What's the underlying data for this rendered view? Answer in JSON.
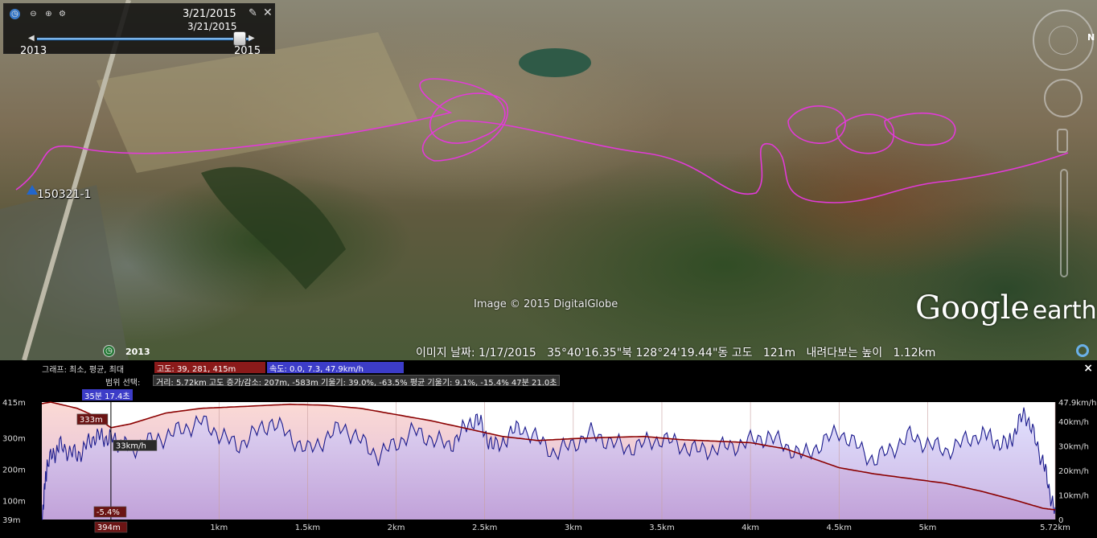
{
  "timebar": {
    "date_current": "3/21/2015",
    "date_slider": "3/21/2015",
    "start_year": "2013",
    "end_year": "2015"
  },
  "map": {
    "placemark_label": "150321-1",
    "imagery_credit": "Image © 2015 DigitalGlobe",
    "logo_google": "Google",
    "logo_earth": "earth",
    "track_color": "#e23ad8"
  },
  "navigation": {
    "north_letter": "N"
  },
  "statusbar": {
    "year_badge": "2013",
    "text": "이미지 날짜: 1/17/2015   35°40'16.35\"북 128°24'19.44\"동 고도   121m   내려다보는 높이   1.12km"
  },
  "profile": {
    "graph_label": "그래프: 최소, 평균, 최대",
    "altitude_stats": "고도: 39, 281, 415m",
    "speed_stats": "속도: 0.0, 7.3, 47.9km/h",
    "range_label": "범위 선택:",
    "range_stats": "거리: 5.72km 고도 증가/감소: 207m, -583m 기울기: 39.0%, -63.5% 평균 기울기: 9.1%, -15.4% 47분 21.0초",
    "time_marker": "35분 17.4초",
    "cursor_altitude": "333m",
    "cursor_speed": "33km/h",
    "cursor_slope": "-5.4%",
    "cursor_distance": "394m",
    "close": "×"
  },
  "colors": {
    "altitude_box": "#8b1a1a",
    "speed_box": "#3c3cc8",
    "altitude_line": "#8b0000",
    "speed_line": "#1a1a8c"
  },
  "chart_data": {
    "type": "area",
    "xlabel": "",
    "x_ticks": [
      "1km",
      "1.5km",
      "2km",
      "2.5km",
      "3km",
      "3.5km",
      "4km",
      "4.5km",
      "5km",
      "5.72km"
    ],
    "xlim": [
      0,
      5.72
    ],
    "y_left_ticks": [
      "415m",
      "300m",
      "200m",
      "100m",
      "39m"
    ],
    "y_right_ticks": [
      "47.9km/h",
      "40km/h",
      "30km/h",
      "20km/h",
      "10km/h",
      "0"
    ],
    "ylim_left": [
      39,
      415
    ],
    "ylim_right": [
      0,
      47.9
    ],
    "series": [
      {
        "name": "고도",
        "unit": "m",
        "x": [
          0,
          0.05,
          0.2,
          0.3,
          0.39,
          0.5,
          0.7,
          0.9,
          1.1,
          1.4,
          1.6,
          1.8,
          2.0,
          2.2,
          2.4,
          2.6,
          2.8,
          3.0,
          3.2,
          3.4,
          3.6,
          3.8,
          4.0,
          4.2,
          4.35,
          4.5,
          4.7,
          4.9,
          5.1,
          5.3,
          5.5,
          5.65,
          5.72
        ],
        "values": [
          410,
          415,
          395,
          370,
          333,
          345,
          380,
          395,
          400,
          408,
          405,
          395,
          375,
          355,
          330,
          305,
          292,
          298,
          302,
          305,
          295,
          290,
          285,
          265,
          235,
          205,
          185,
          170,
          155,
          130,
          100,
          75,
          70
        ]
      },
      {
        "name": "속도",
        "unit": "km/h",
        "x": [
          0,
          0.03,
          0.1,
          0.2,
          0.3,
          0.39,
          0.5,
          0.7,
          0.9,
          1.1,
          1.3,
          1.5,
          1.7,
          1.9,
          2.1,
          2.3,
          2.45,
          2.55,
          2.7,
          2.9,
          3.1,
          3.3,
          3.5,
          3.7,
          3.9,
          4.1,
          4.3,
          4.5,
          4.7,
          4.9,
          5.1,
          5.3,
          5.45,
          5.55,
          5.65,
          5.72
        ],
        "values": [
          0,
          23,
          30,
          26,
          34,
          33,
          29,
          34,
          40,
          30,
          40,
          28,
          38,
          26,
          36,
          30,
          42,
          29,
          38,
          27,
          35,
          29,
          33,
          28,
          30,
          34,
          26,
          36,
          24,
          34,
          28,
          35,
          30,
          44,
          24,
          2
        ]
      }
    ]
  }
}
